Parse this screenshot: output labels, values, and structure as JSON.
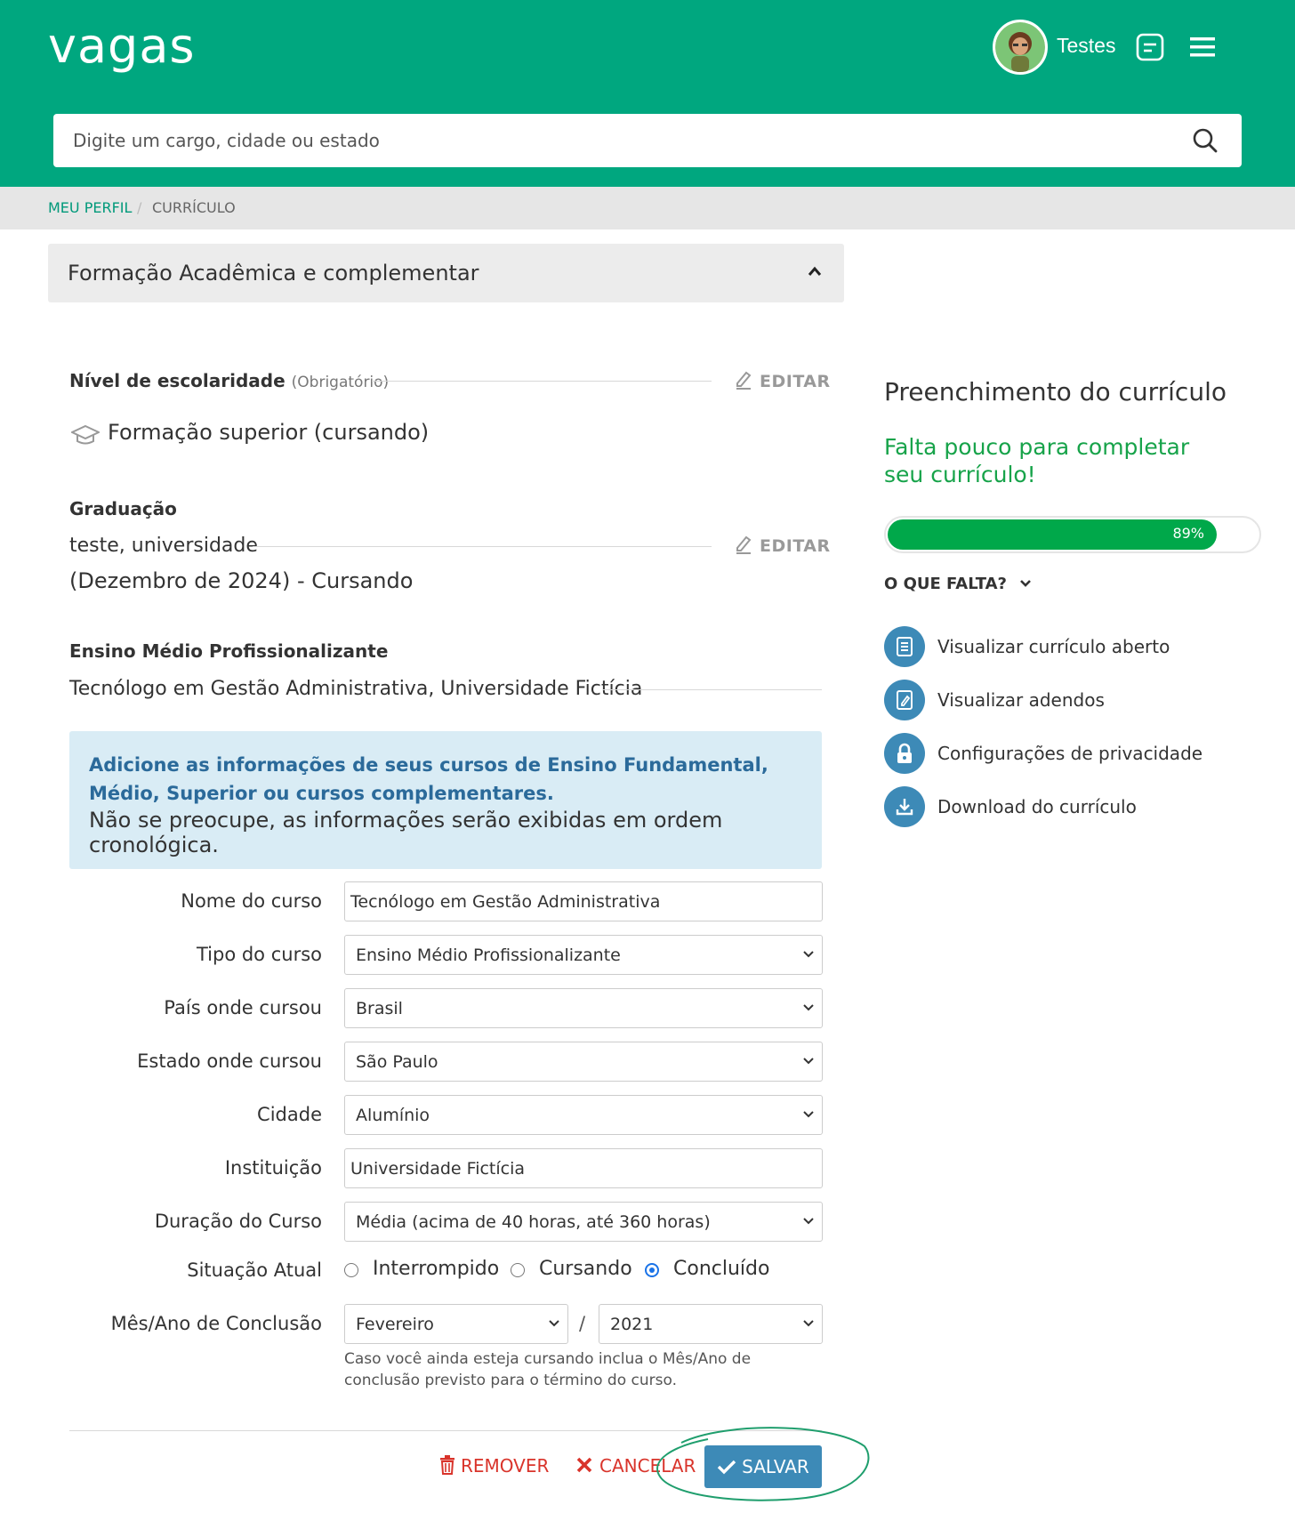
{
  "header": {
    "logo": "vagas",
    "user_name": "Testes",
    "search_placeholder": "Digite um cargo, cidade ou estado"
  },
  "breadcrumb": {
    "link": "MEU PERFIL",
    "separator": "/",
    "current": "CURRÍCULO"
  },
  "section": {
    "title": "Formação Acadêmica e complementar"
  },
  "education": {
    "level_label": "Nível de escolaridade",
    "level_required": "(Obrigatório)",
    "edit_label": "EDITAR",
    "level_value": "Formação superior (cursando)",
    "grad_label": "Graduação",
    "grad_line1": "teste, universidade",
    "grad_line2": "(Dezembro de 2024) - Cursando",
    "em_label": "Ensino Médio Profissionalizante",
    "em_value": "Tecnólogo em Gestão Administrativa, Universidade Fictícia"
  },
  "info_box": {
    "strong": "Adicione as informações de seus cursos de Ensino Fundamental, Médio, Superior ou cursos complementares.",
    "normal": "Não se preocupe, as informações serão exibidas em ordem cronológica."
  },
  "form": {
    "course_name_label": "Nome do curso",
    "course_name_value": "Tecnólogo em Gestão Administrativa",
    "course_type_label": "Tipo do curso",
    "course_type_value": "Ensino Médio Profissionalizante",
    "country_label": "País onde cursou",
    "country_value": "Brasil",
    "state_label": "Estado onde cursou",
    "state_value": "São Paulo",
    "city_label": "Cidade",
    "city_value": "Alumínio",
    "institution_label": "Instituição",
    "institution_value": "Universidade Fictícia",
    "duration_label": "Duração do Curso",
    "duration_value": "Média (acima de 40 horas, até 360 horas)",
    "status_label": "Situação Atual",
    "status_options": [
      "Interrompido",
      "Cursando",
      "Concluído"
    ],
    "status_selected": "Concluído",
    "completion_label": "Mês/Ano de Conclusão",
    "month_value": "Fevereiro",
    "date_separator": "/",
    "year_value": "2021",
    "help_text": "Caso você ainda esteja cursando inclua o Mês/Ano de conclusão previsto para o término do curso."
  },
  "actions": {
    "remove": "REMOVER",
    "cancel": "CANCELAR",
    "save": "SALVAR"
  },
  "right_panel": {
    "title": "Preenchimento do currículo",
    "subtitle": "Falta pouco para completar seu currículo!",
    "progress_percent": 89,
    "progress_label": "89%",
    "missing_label": "O QUE FALTA?",
    "items": [
      {
        "label": "Visualizar currículo aberto",
        "icon": "document-icon"
      },
      {
        "label": "Visualizar adendos",
        "icon": "document-edit-icon"
      },
      {
        "label": "Configurações de privacidade",
        "icon": "lock-icon"
      },
      {
        "label": "Download do currículo",
        "icon": "download-icon"
      }
    ]
  },
  "colors": {
    "brand": "#00a77f",
    "accent_blue": "#3d8ab7",
    "danger": "#d9342b",
    "success": "#00a84a"
  }
}
